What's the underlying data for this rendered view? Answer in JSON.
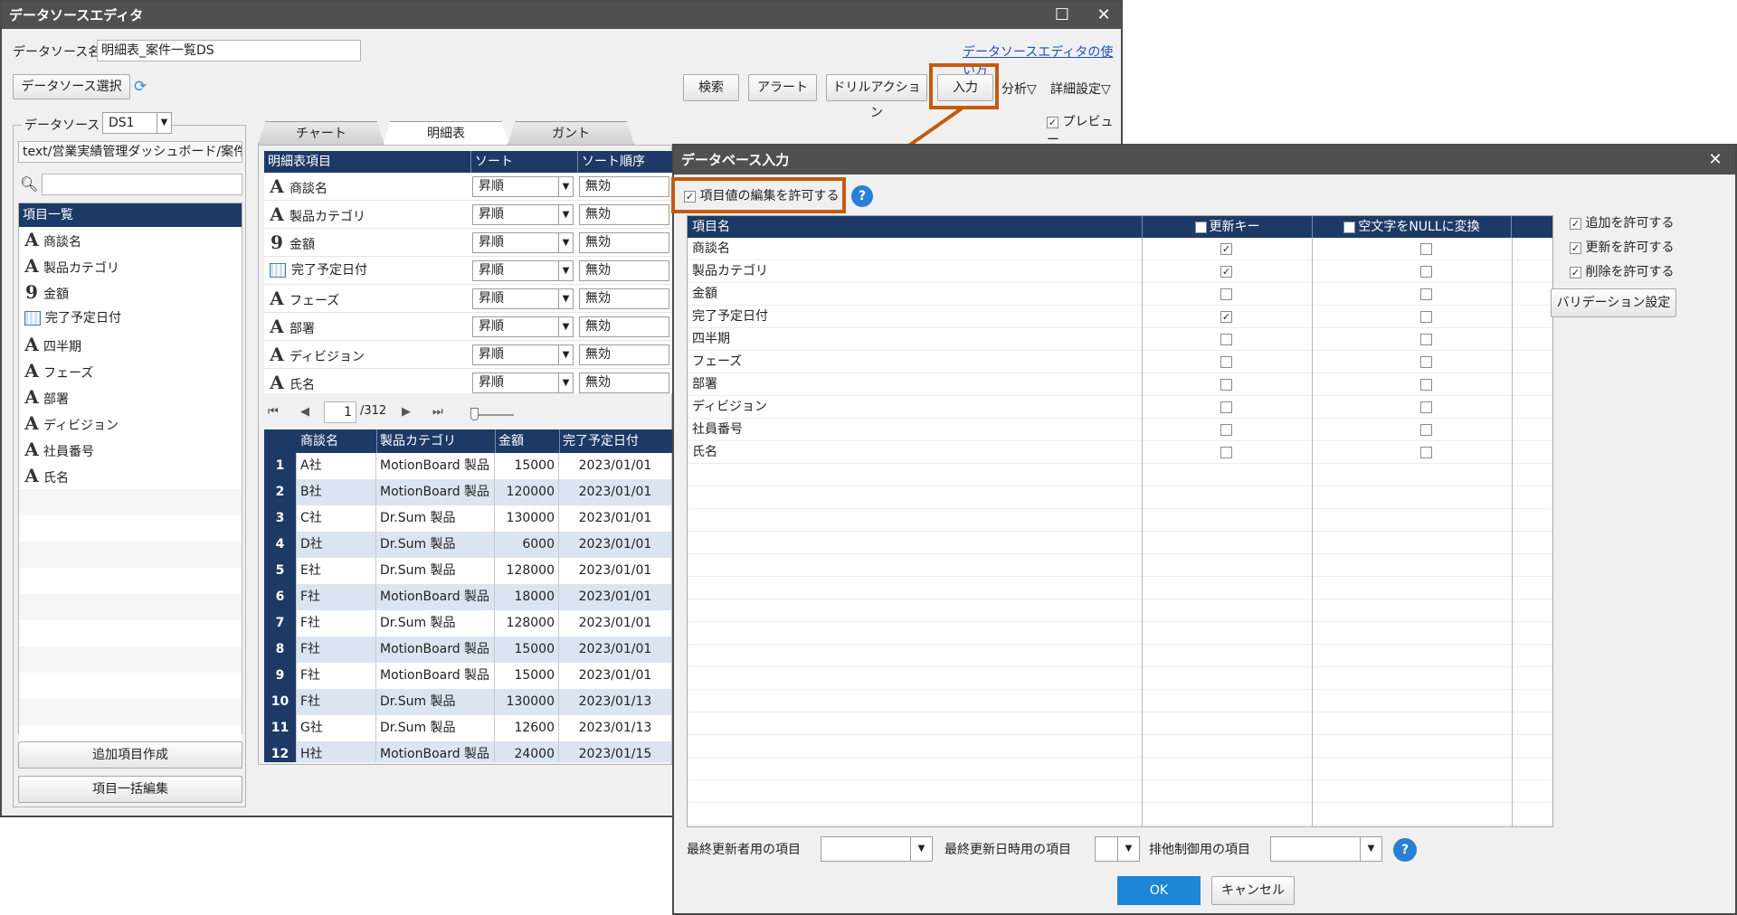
{
  "main": {
    "title": "データソースエディタ",
    "ds_name_label": "データソース名",
    "ds_name_value": "明細表_案件一覧DS",
    "help_link": "データソースエディタの使い方",
    "select_ds_button": "データソース選択",
    "toolbar": {
      "search": "検索",
      "alert": "アラート",
      "drill": "ドリルアクション",
      "input": "入力",
      "analysis": "分析▽",
      "detail": "詳細設定▽",
      "preview": "プレビュー"
    },
    "datasource_label": "データソース",
    "datasource_value": "DS1",
    "path": "text/営業実績管理ダッシュボード/案件デ",
    "item_list_header": "項目一覧",
    "items": [
      {
        "icon": "A",
        "label": "商談名"
      },
      {
        "icon": "A",
        "label": "製品カテゴリ"
      },
      {
        "icon": "9",
        "label": "金額"
      },
      {
        "icon": "cal",
        "label": "完了予定日付"
      },
      {
        "icon": "A",
        "label": "四半期"
      },
      {
        "icon": "A",
        "label": "フェーズ"
      },
      {
        "icon": "A",
        "label": "部署"
      },
      {
        "icon": "A",
        "label": "ディビジョン"
      },
      {
        "icon": "A",
        "label": "社員番号"
      },
      {
        "icon": "A",
        "label": "氏名"
      }
    ],
    "add_item_button": "追加項目作成",
    "bulk_edit_button": "項目一括編集",
    "tabs": [
      "チャート",
      "明細表",
      "ガント"
    ],
    "detail_headers": [
      "明細表項目",
      "ソート",
      "ソート順序"
    ],
    "detail_rows": [
      {
        "icon": "A",
        "label": "商談名",
        "sort": "昇順",
        "order": "無効"
      },
      {
        "icon": "A",
        "label": "製品カテゴリ",
        "sort": "昇順",
        "order": "無効"
      },
      {
        "icon": "9",
        "label": "金額",
        "sort": "昇順",
        "order": "無効"
      },
      {
        "icon": "cal",
        "label": "完了予定日付",
        "sort": "昇順",
        "order": "無効"
      },
      {
        "icon": "A",
        "label": "フェーズ",
        "sort": "昇順",
        "order": "無効"
      },
      {
        "icon": "A",
        "label": "部署",
        "sort": "昇順",
        "order": "無効"
      },
      {
        "icon": "A",
        "label": "ディビジョン",
        "sort": "昇順",
        "order": "無効"
      },
      {
        "icon": "A",
        "label": "氏名",
        "sort": "昇順",
        "order": "無効"
      }
    ],
    "pager": {
      "page": "1",
      "total": "/312"
    },
    "preview_headers": [
      "商談名",
      "製品カテゴリ",
      "金額",
      "完了予定日付"
    ],
    "preview_rows": [
      [
        "1",
        "A社",
        "MotionBoard 製品",
        "15000",
        "2023/01/01"
      ],
      [
        "2",
        "B社",
        "MotionBoard 製品",
        "120000",
        "2023/01/01"
      ],
      [
        "3",
        "C社",
        "Dr.Sum 製品",
        "130000",
        "2023/01/01"
      ],
      [
        "4",
        "D社",
        "Dr.Sum 製品",
        "6000",
        "2023/01/01"
      ],
      [
        "5",
        "E社",
        "Dr.Sum 製品",
        "128000",
        "2023/01/01"
      ],
      [
        "6",
        "F社",
        "MotionBoard 製品",
        "18000",
        "2023/01/01"
      ],
      [
        "7",
        "F社",
        "Dr.Sum 製品",
        "128000",
        "2023/01/01"
      ],
      [
        "8",
        "F社",
        "MotionBoard 製品",
        "15000",
        "2023/01/01"
      ],
      [
        "9",
        "F社",
        "MotionBoard 製品",
        "15000",
        "2023/01/01"
      ],
      [
        "10",
        "F社",
        "Dr.Sum 製品",
        "130000",
        "2023/01/13"
      ],
      [
        "11",
        "G社",
        "Dr.Sum 製品",
        "12600",
        "2023/01/13"
      ],
      [
        "12",
        "H社",
        "MotionBoard 製品",
        "24000",
        "2023/01/15"
      ]
    ]
  },
  "dialog": {
    "title": "データベース入力",
    "allow_edit_label": "項目値の編集を許可する",
    "headers": {
      "name": "項目名",
      "key": "更新キー",
      "null": "空文字をNULLに変換"
    },
    "rows": [
      {
        "name": "商談名",
        "key": true,
        "null": false
      },
      {
        "name": "製品カテゴリ",
        "key": true,
        "null": false
      },
      {
        "name": "金額",
        "key": false,
        "null": false
      },
      {
        "name": "完了予定日付",
        "key": true,
        "null": false
      },
      {
        "name": "四半期",
        "key": false,
        "null": false
      },
      {
        "name": "フェーズ",
        "key": false,
        "null": false
      },
      {
        "name": "部署",
        "key": false,
        "null": false
      },
      {
        "name": "ディビジョン",
        "key": false,
        "null": false
      },
      {
        "name": "社員番号",
        "key": false,
        "null": false
      },
      {
        "name": "氏名",
        "key": false,
        "null": false
      }
    ],
    "allow_add": "追加を許可する",
    "allow_update": "更新を許可する",
    "allow_delete": "削除を許可する",
    "validation_button": "バリデーション設定",
    "last_user_label": "最終更新者用の項目",
    "last_time_label": "最終更新日時用の項目",
    "lock_label": "排他制御用の項目",
    "ok": "OK",
    "cancel": "キャンセル"
  },
  "colors": {
    "header_navy": "#1d3a66",
    "highlight": "#c55a11",
    "ok_blue": "#1e86d6"
  }
}
